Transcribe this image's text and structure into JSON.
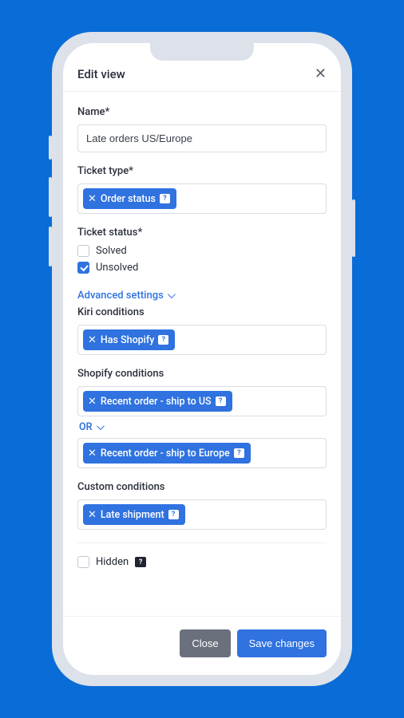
{
  "header": {
    "title": "Edit view"
  },
  "form": {
    "name_label": "Name*",
    "name_value": "Late orders US/Europe",
    "ticket_type_label": "Ticket type*",
    "ticket_type_tags": [
      "Order status"
    ],
    "ticket_status_label": "Ticket status*",
    "status_options": [
      {
        "label": "Solved",
        "checked": false
      },
      {
        "label": "Unsolved",
        "checked": true
      }
    ],
    "advanced_toggle": "Advanced settings",
    "kiri_label": "Kiri conditions",
    "kiri_tags": [
      "Has Shopify"
    ],
    "shopify_label": "Shopify conditions",
    "shopify_group1_tags": [
      "Recent order - ship to US"
    ],
    "shopify_or": "OR",
    "shopify_group2_tags": [
      "Recent order - ship to Europe"
    ],
    "custom_label": "Custom conditions",
    "custom_tags": [
      "Late shipment"
    ],
    "hidden_label": "Hidden",
    "hidden_checked": false
  },
  "footer": {
    "close": "Close",
    "save": "Save changes"
  }
}
